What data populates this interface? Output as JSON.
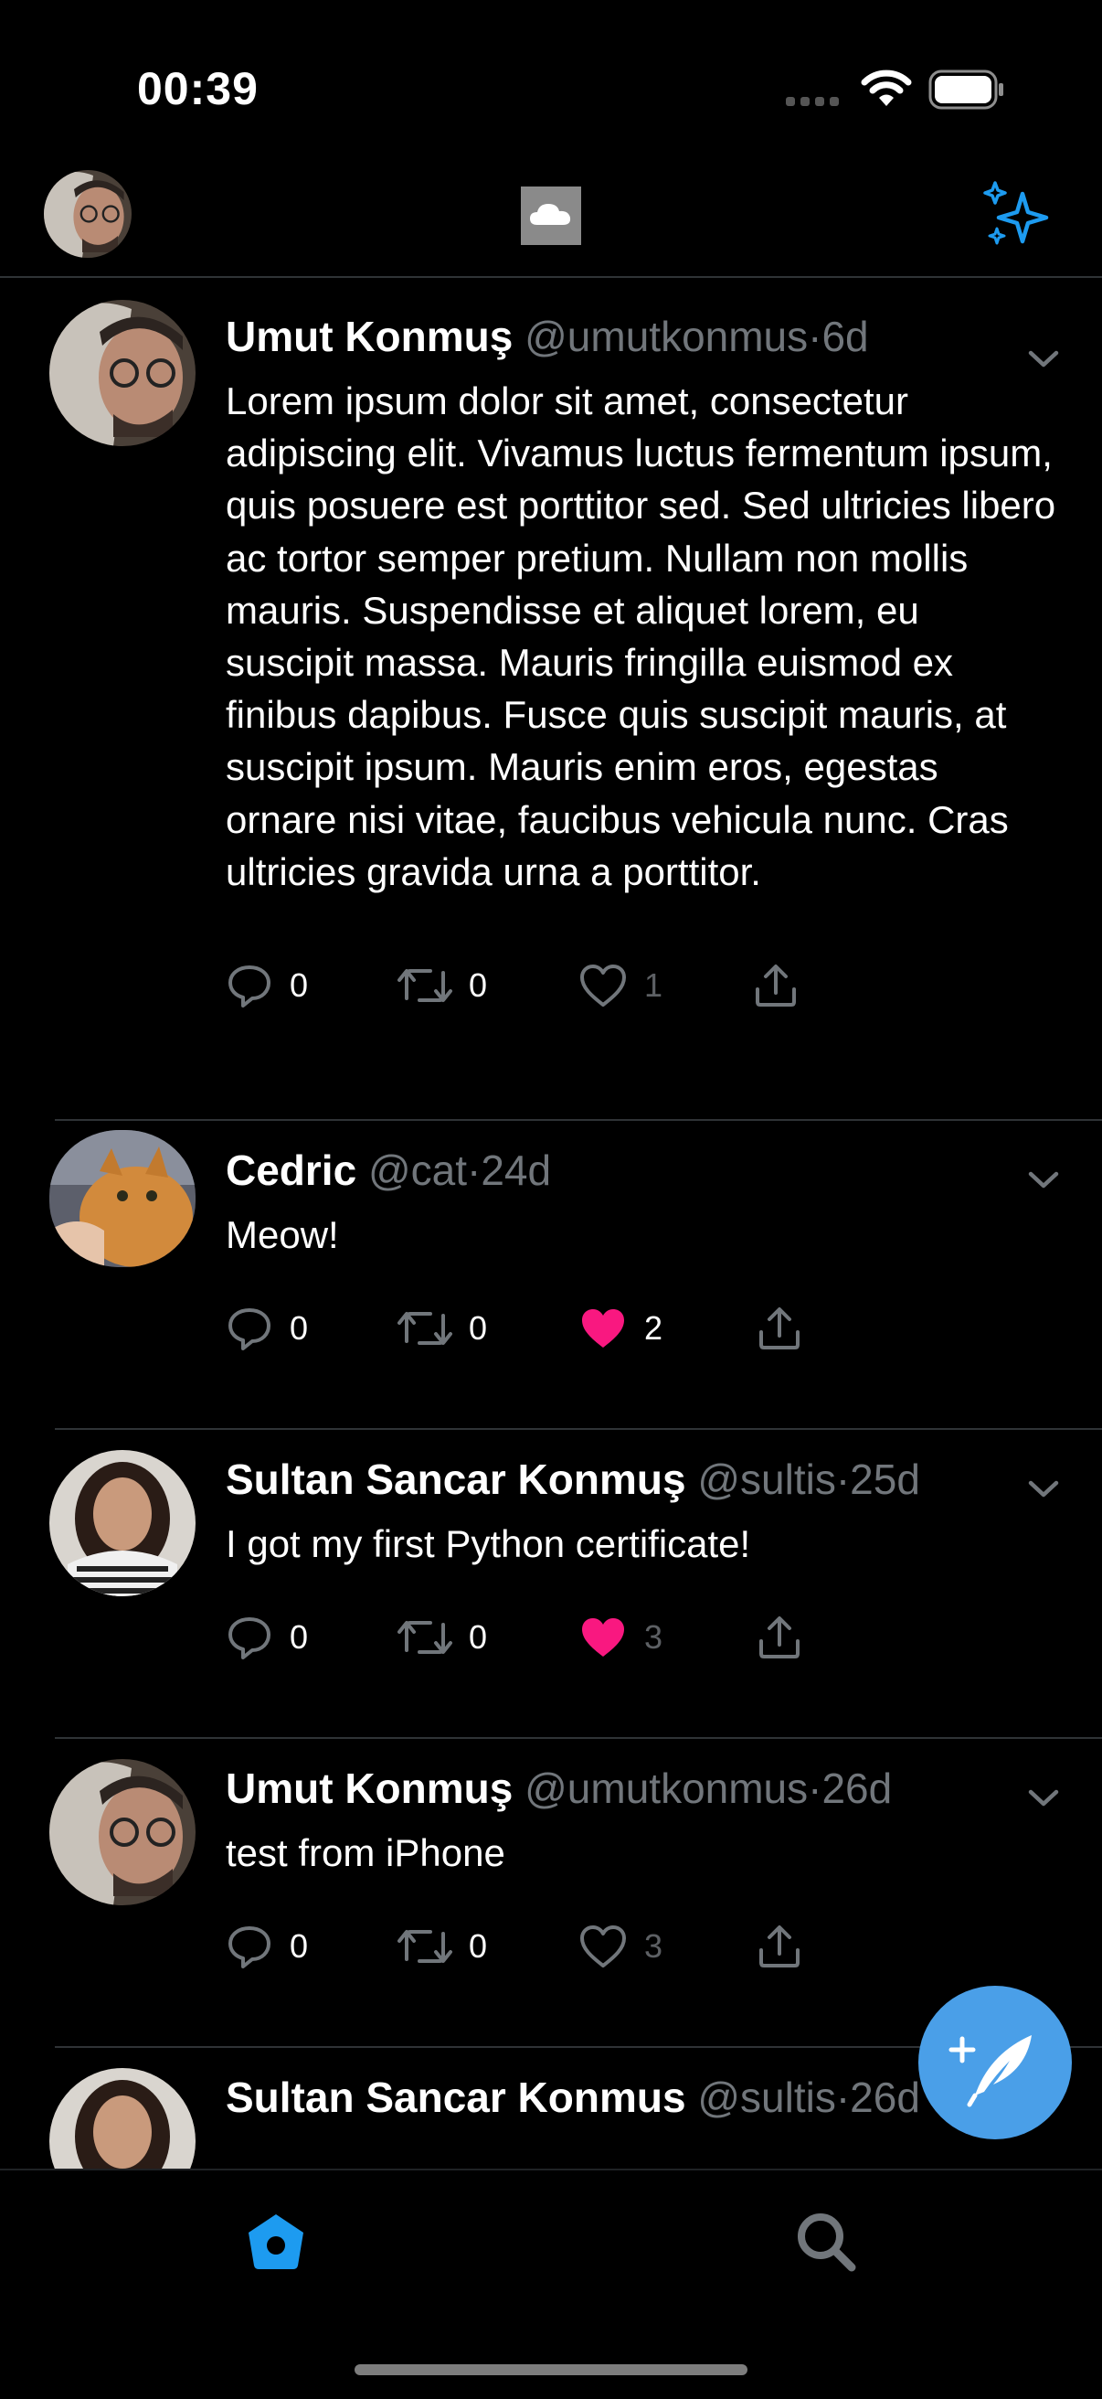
{
  "status_bar": {
    "time": "00:39"
  },
  "tweets": [
    {
      "name": "Umut Konmuş",
      "handle": "@umutkonmus",
      "time": "6d",
      "text": "Lorem ipsum dolor sit amet, consectetur adipiscing elit. Vivamus luctus fermentum ipsum, quis posuere est porttitor sed. Sed ultricies libero ac tortor semper pretium. Nullam non mollis mauris. Suspendisse et aliquet lorem, eu suscipit massa. Mauris fringilla euismod ex finibus dapibus. Fusce quis suscipit mauris, at suscipit ipsum. Mauris enim eros, egestas ornare nisi vitae, faucibus vehicula nunc. Cras ultricies gravida urna a porttitor.",
      "replies": "0",
      "retweets": "0",
      "likes": "1",
      "liked": false
    },
    {
      "name": "Cedric",
      "handle": "@cat",
      "time": "24d",
      "text": "Meow!",
      "replies": "0",
      "retweets": "0",
      "likes": "2",
      "liked": true
    },
    {
      "name": "Sultan Sancar Konmuş",
      "handle": "@sultis",
      "time": "25d",
      "text": "I got my first Python certificate!",
      "replies": "0",
      "retweets": "0",
      "likes": "3",
      "liked": true
    },
    {
      "name": "Umut Konmuş",
      "handle": "@umutkonmus",
      "time": "26d",
      "text": "test from iPhone",
      "replies": "0",
      "retweets": "0",
      "likes": "3",
      "liked": false
    },
    {
      "name": "Sultan Sancar Konmus",
      "handle": "@sultis",
      "time": "26d"
    }
  ],
  "colors": {
    "accent": "#1d9bf0",
    "fab": "#4a9fe8",
    "like_active": "#f91880",
    "muted": "#71767b",
    "divider": "#2f3336"
  },
  "icons": {
    "reply": "speech-bubble",
    "retweet": "retweet-arrows",
    "like": "heart",
    "share": "share-up-arrow",
    "compose": "feather-plus",
    "home": "home",
    "search": "magnifier",
    "sparkle": "sparkle-stars"
  }
}
